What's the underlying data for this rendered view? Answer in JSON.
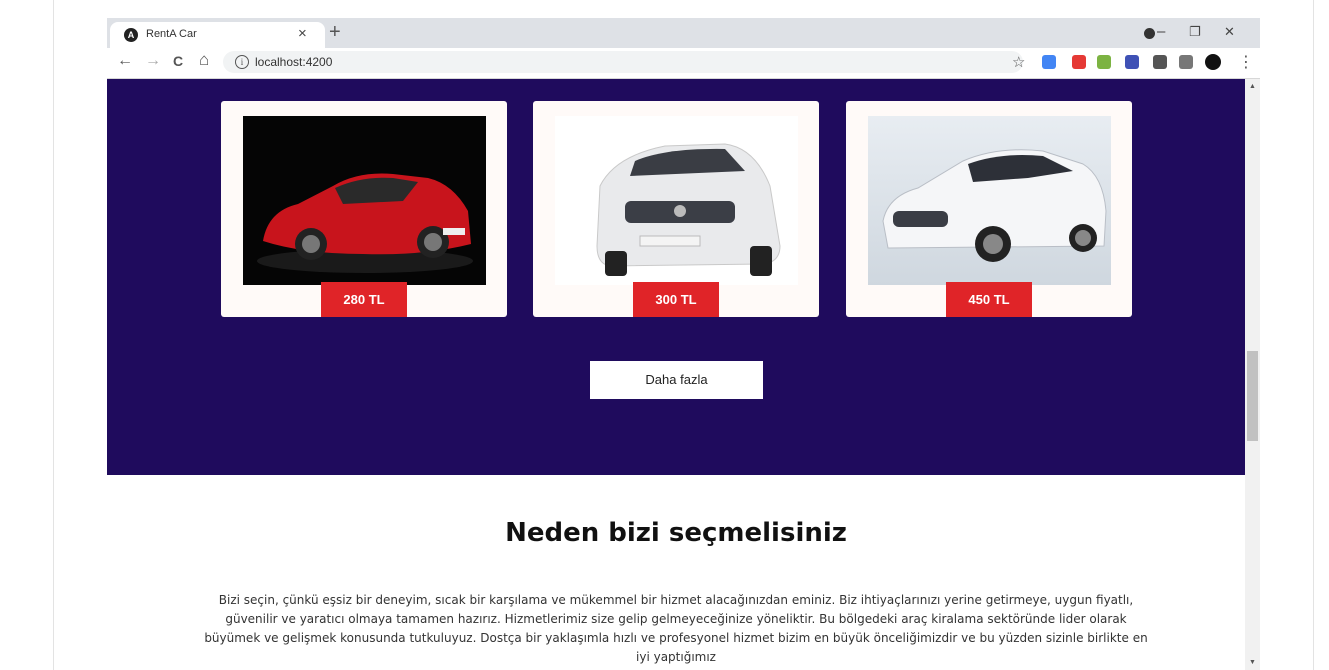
{
  "tab": {
    "title": "RentA Car",
    "close_symbol": "×",
    "new_tab_symbol": "+"
  },
  "window_controls": {
    "minimize": "–",
    "restore": "❐",
    "close": "✕"
  },
  "toolbar": {
    "back": "←",
    "forward": "→",
    "reload": "C",
    "home": "⌂",
    "info_icon": "i",
    "url": "localhost:4200",
    "bookmark_star": "☆",
    "menu": "⋮"
  },
  "extensions": [
    {
      "name": "translate-icon",
      "color": "#4285f4"
    },
    {
      "name": "eyedropper-icon",
      "color": "#e53935"
    },
    {
      "name": "extension-green-icon",
      "color": "#7cb342"
    },
    {
      "name": "extension-hat-icon",
      "color": "#3f51b5"
    },
    {
      "name": "puzzle-icon",
      "color": "#555555"
    },
    {
      "name": "media-icon",
      "color": "#555555"
    },
    {
      "name": "avatar-icon",
      "color": "#111111"
    }
  ],
  "cars": [
    {
      "price": "280 TL"
    },
    {
      "price": "300 TL"
    },
    {
      "price": "450 TL"
    }
  ],
  "more_button": "Daha fazla",
  "why_us": {
    "title": "Neden bizi seçmelisiniz",
    "text": "Bizi seçin, çünkü eşsiz bir deneyim, sıcak bir karşılama ve mükemmel bir hizmet alacağınızdan eminiz. Biz ihtiyaçlarınızı yerine getirmeye, uygun fiyatlı, güvenilir ve yaratıcı olmaya tamamen hazırız. Hizmetlerimiz size gelip gelmeyeceğinize yöneliktir. Bu bölgedeki araç kiralama sektöründe lider olarak büyümek ve gelişmek konusunda tutkuluyuz. Dostça bir yaklaşımla hızlı ve profesyonel hizmet bizim en büyük önceliğimizdir ve bu yüzden sizinle birlikte en iyi yaptığımız"
  },
  "colors": {
    "hero_background": "#1f0b5d",
    "price_badge": "#e02428",
    "card_background": "#fffaf8"
  }
}
